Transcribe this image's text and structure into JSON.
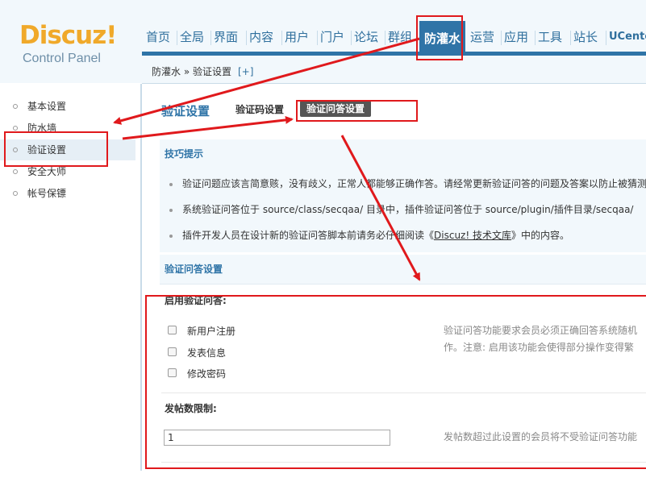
{
  "logo": {
    "word": "Discuz!",
    "subtitle": "Control Panel"
  },
  "nav": [
    "首页",
    "全局",
    "界面",
    "内容",
    "用户",
    "门户",
    "论坛",
    "群组",
    "防灌水",
    "运营",
    "应用",
    "工具",
    "站长",
    "UCenter"
  ],
  "nav_active": "防灌水",
  "breadcrumb": {
    "text": "防灌水 » 验证设置",
    "plus": "[+]"
  },
  "sidebar": [
    "基本设置",
    "防水墙",
    "验证设置",
    "安全大师",
    "帐号保镖"
  ],
  "sidebar_active": "验证设置",
  "main": {
    "title": "验证设置",
    "tabs": [
      "验证码设置",
      "验证问答设置"
    ],
    "tips_title": "技巧提示",
    "tips": [
      "验证问题应该言简意赅，没有歧义，正常人都能够正确作答。请经常更新验证问答的问题及答案以防止被猜测",
      "系统验证问答位于 source/class/secqaa/ 目录中，插件验证问答位于 source/plugin/插件目录/secqaa/",
      "插件开发人员在设计新的验证问答脚本前请务必仔细阅读《"
    ],
    "tips_link": "Discuz! 技术文库",
    "tips_link_after": "》中的内容。",
    "section_title": "验证问答设置",
    "enable_title": "启用验证问答:",
    "options": [
      "新用户注册",
      "发表信息",
      "修改密码"
    ],
    "enable_tip": [
      "验证问答功能要求会员必须正确回答系统随机",
      "作。注意: 启用该功能会使得部分操作变得繁"
    ],
    "post_title": "发帖数限制:",
    "post_value": "1",
    "post_tip": "发帖数超过此设置的会员将不受验证问答功能"
  },
  "colors": {
    "brand": "#2f74a7",
    "logo": "#f0a92a",
    "annotation": "#e0191c"
  }
}
